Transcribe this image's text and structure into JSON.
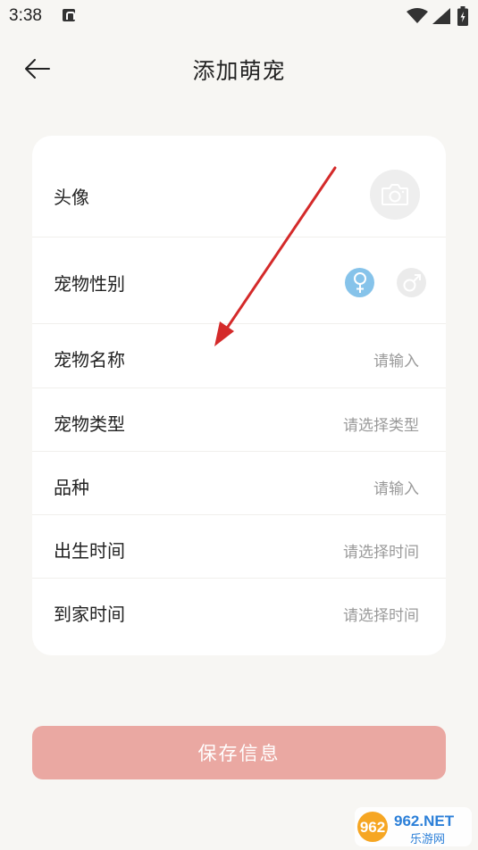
{
  "status_bar": {
    "time": "3:38",
    "icons": [
      "notification-a-icon",
      "wifi-icon",
      "signal-icon",
      "battery-charging-icon"
    ]
  },
  "header": {
    "title": "添加萌宠",
    "back_icon": "arrow-left-icon"
  },
  "form": {
    "avatar_label": "头像",
    "avatar_icon": "camera-icon",
    "gender_label": "宠物性别",
    "gender_options": [
      {
        "icon": "female-icon",
        "selected": true,
        "color": "#86c3ea"
      },
      {
        "icon": "male-icon",
        "selected": false,
        "color": "#ebebeb"
      }
    ],
    "fields": [
      {
        "label": "宠物名称",
        "value": "请输入"
      },
      {
        "label": "宠物类型",
        "value": "请选择类型"
      },
      {
        "label": "品种",
        "value": "请输入"
      },
      {
        "label": "出生时间",
        "value": "请选择时间"
      },
      {
        "label": "到家时间",
        "value": "请选择时间"
      }
    ]
  },
  "save_button": {
    "label": "保存信息",
    "color": "#eaa8a2"
  },
  "annotation": {
    "color": "#d42a2a"
  },
  "watermark": {
    "text_top": "962.NET",
    "text_bottom": "乐游网"
  }
}
